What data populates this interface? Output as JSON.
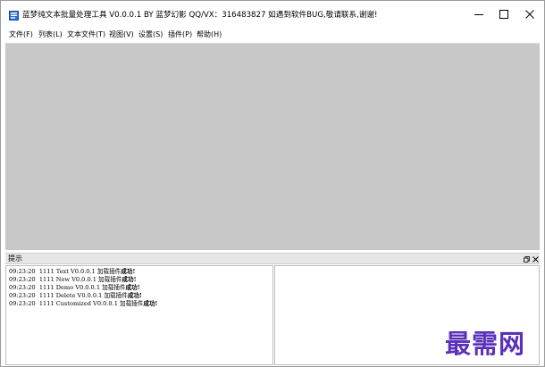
{
  "window": {
    "title": "蓝梦纯文本批量处理工具 V0.0.0.1 BY 蓝梦幻影 QQ/VX：316483827 如遇到软件BUG,敬请联系,谢谢!"
  },
  "menu": [
    {
      "label": "文件(F)"
    },
    {
      "label": "列表(L)"
    },
    {
      "label": "文本文件(T)"
    },
    {
      "label": "视图(V)"
    },
    {
      "label": "设置(S)"
    },
    {
      "label": "插件(P)"
    },
    {
      "label": "帮助(H)"
    }
  ],
  "panel": {
    "title": "提示"
  },
  "log": [
    {
      "time": "09:23:20",
      "text": "1111 Text V0.0.0.1 加载插件",
      "status": "成功!"
    },
    {
      "time": "09:23:20",
      "text": "1111 New V0.0.0.1 加载插件",
      "status": "成功!"
    },
    {
      "time": "09:23:20",
      "text": "1111 Demo V0.0.0.1 加载插件",
      "status": "成功!"
    },
    {
      "time": "09:23:20",
      "text": "1111 Delete V0.0.0.1 加载插件",
      "status": "成功!"
    },
    {
      "time": "09:23:20",
      "text": "1111 Customized V0.0.0.1 加载插件",
      "status": "成功!"
    }
  ],
  "watermark": "最需网",
  "colors": {
    "workspace": "#c8c8c8",
    "watermark": "#5a31b8"
  }
}
